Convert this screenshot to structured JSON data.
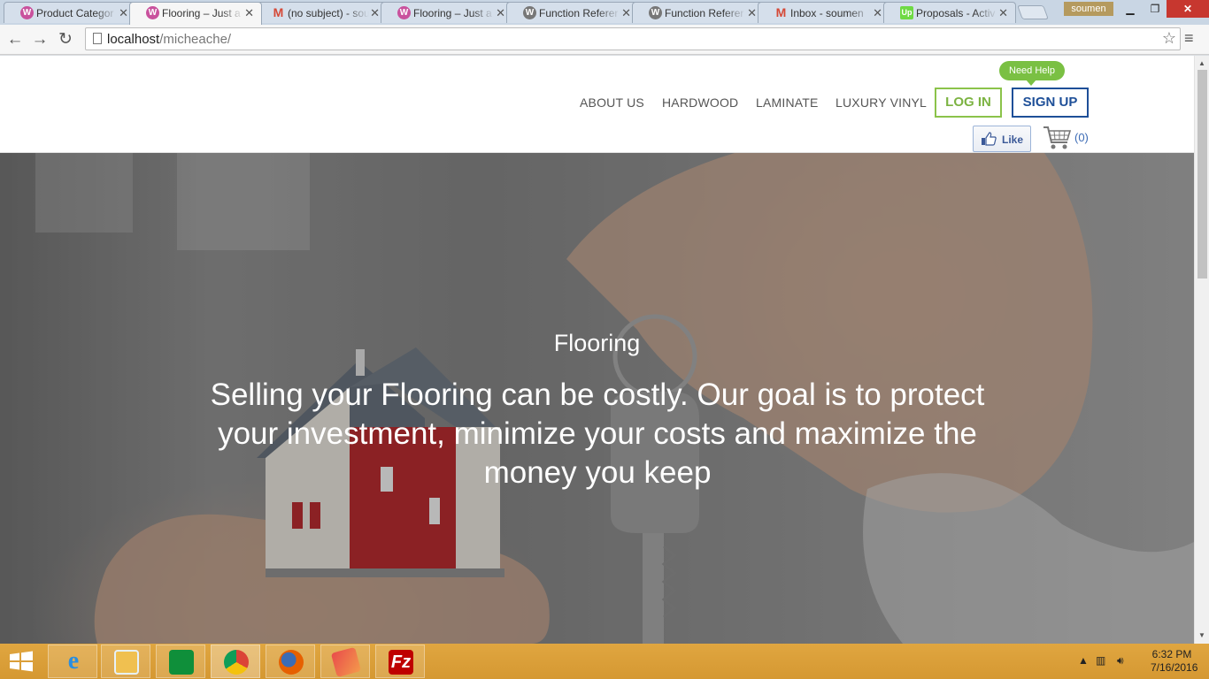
{
  "browser": {
    "tabs": [
      {
        "title": "Product Categor",
        "favicon": "woocommerce-icon"
      },
      {
        "title": "Flooring – Just a",
        "favicon": "woocommerce-icon",
        "active": true
      },
      {
        "title": "(no subject) - sou",
        "favicon": "gmail-icon"
      },
      {
        "title": "Flooring – Just a",
        "favicon": "woocommerce-icon"
      },
      {
        "title": "Function Referer",
        "favicon": "wordpress-icon"
      },
      {
        "title": "Function Referer",
        "favicon": "wordpress-icon"
      },
      {
        "title": "Inbox - soumen",
        "favicon": "gmail-icon"
      },
      {
        "title": "Proposals - Activ",
        "favicon": "upwork-icon"
      }
    ],
    "profile_name": "soumen",
    "url_host": "localhost",
    "url_path": "/micheache/"
  },
  "header": {
    "help_bubble": "Need Help",
    "nav": [
      "ABOUT US",
      "HARDWOOD",
      "LAMINATE",
      "LUXURY VINYL"
    ],
    "login_label": "LOG IN",
    "signup_label": "SIGN UP",
    "like_label": "Like",
    "cart_count": "(0)",
    "colors": {
      "login": "#8bc34a",
      "signup": "#1e4f98"
    }
  },
  "hero": {
    "title": "Flooring",
    "text": "Selling your Flooring can be costly. Our goal is to protect your investment, minimize your costs and maximize the money you keep"
  },
  "taskbar": {
    "apps": [
      "internet-explorer-icon",
      "file-explorer-icon",
      "store-icon",
      "chrome-icon",
      "firefox-icon",
      "app-icon",
      "filezilla-icon"
    ],
    "time": "6:32 PM",
    "date": "7/16/2016"
  }
}
